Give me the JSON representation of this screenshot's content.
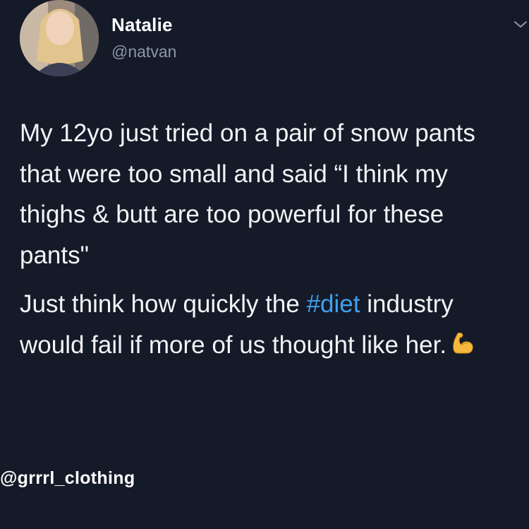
{
  "tweet": {
    "display_name": "Natalie",
    "handle": "@natvan",
    "paragraph1": "My 12yo just tried on a pair of snow pants that were too small and said “I think my thighs & butt are too powerful for these pants\"",
    "paragraph2_before": "Just think how quickly the ",
    "hashtag": "#diet",
    "paragraph2_after": " industry would fail if more of us thought like her.",
    "emoji_icon": "flexed-biceps-icon",
    "menu_icon": "chevron-down-icon"
  },
  "watermark": "@grrrl_clothing",
  "colors": {
    "background": "#151a29",
    "text": "#f2f3f5",
    "handle": "#8b98a5",
    "hashtag": "#3ea2ee"
  }
}
